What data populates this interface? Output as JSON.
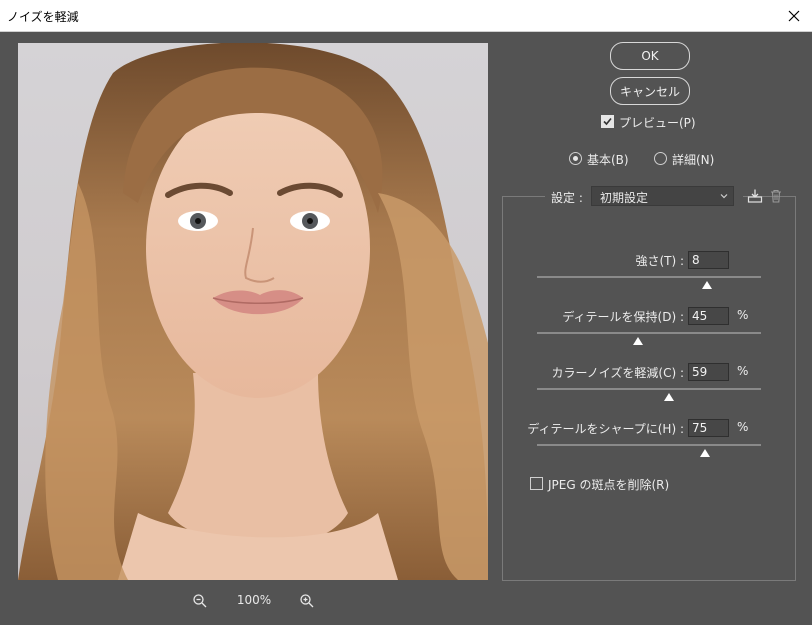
{
  "window": {
    "title": "ノイズを軽減",
    "close_glyph": "✕"
  },
  "preview": {
    "zoom_level": "100%",
    "zoom_out_icon": "zoom-out-icon",
    "zoom_in_icon": "zoom-in-icon"
  },
  "buttons": {
    "ok": "OK",
    "cancel": "キャンセル"
  },
  "preview_toggle": {
    "label": "プレビュー(P)",
    "checked": true
  },
  "mode": {
    "basic": {
      "label": "基本(B)",
      "selected": true
    },
    "advanced": {
      "label": "詳細(N)",
      "selected": false
    }
  },
  "settings": {
    "label": "設定 :",
    "preset_value": "初期設定",
    "save_icon": "save-preset-icon",
    "delete_icon": "trash-icon"
  },
  "sliders": [
    {
      "label": "強さ(T) :",
      "value": "8",
      "unit": "",
      "fraction": 0.76
    },
    {
      "label": "ディテールを保持(D) :",
      "value": "45",
      "unit": "%",
      "fraction": 0.45
    },
    {
      "label": "カラーノイズを軽減(C) :",
      "value": "59",
      "unit": "%",
      "fraction": 0.59
    },
    {
      "label": "ディテールをシャープに(H) :",
      "value": "75",
      "unit": "%",
      "fraction": 0.75
    }
  ],
  "jpeg_artifact": {
    "label": "JPEG の斑点を削除(R)",
    "checked": false
  },
  "colors": {
    "panel": "#535353",
    "titlebar": "#ffffff",
    "text": "#ececec"
  }
}
